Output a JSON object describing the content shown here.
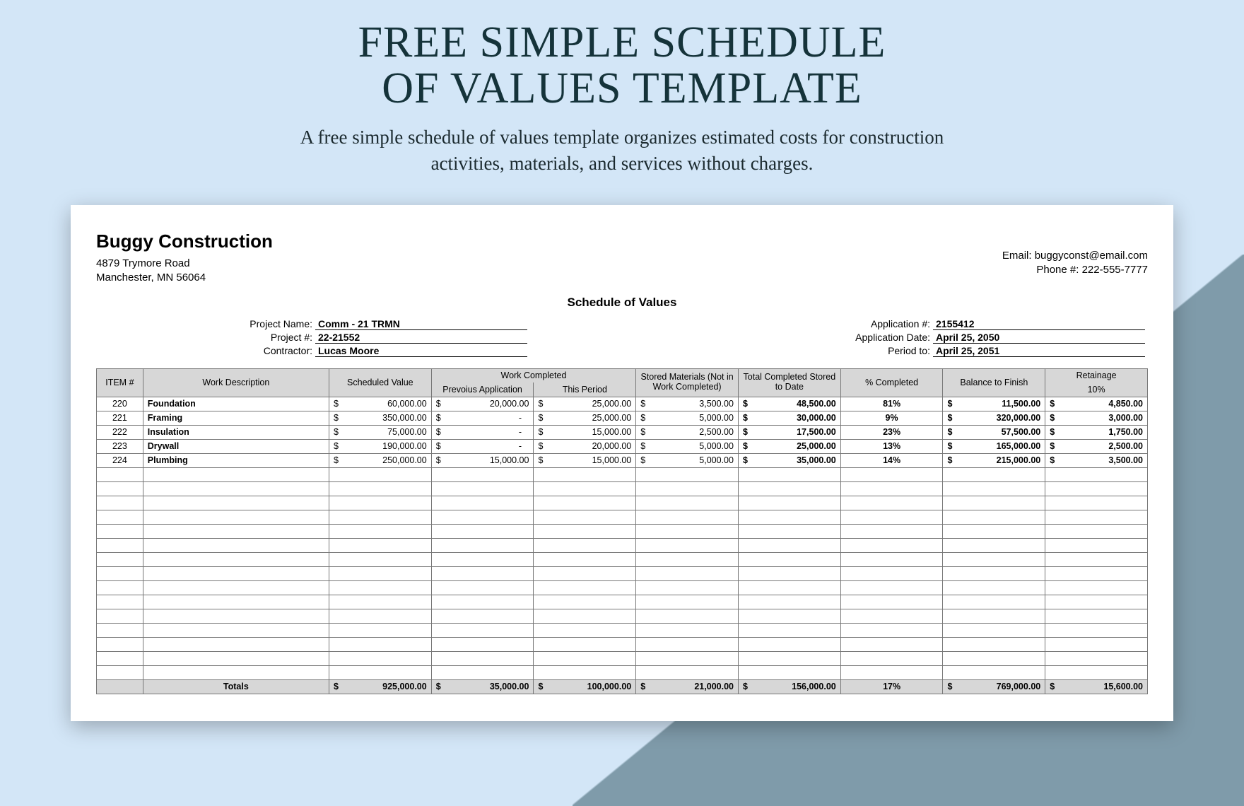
{
  "hero": {
    "title_l1": "FREE SIMPLE SCHEDULE",
    "title_l2": "OF VALUES TEMPLATE",
    "sub_l1": "A free simple schedule of values template organizes estimated costs for construction",
    "sub_l2": "activities, materials, and services without charges."
  },
  "company": {
    "name": "Buggy Construction",
    "addr1": "4879 Trymore Road",
    "addr2": "Manchester, MN 56064",
    "email": "Email: buggyconst@email.com",
    "phone": "Phone #: 222-555-7777"
  },
  "doc_title": "Schedule of Values",
  "meta_left": {
    "project_name_lbl": "Project Name:",
    "project_name": "Comm - 21 TRMN",
    "project_no_lbl": "Project #:",
    "project_no": "22-21552",
    "contractor_lbl": "Contractor:",
    "contractor": "Lucas Moore"
  },
  "meta_right": {
    "app_no_lbl": "Application #:",
    "app_no": "2155412",
    "app_date_lbl": "Application Date:",
    "app_date": "April 25, 2050",
    "period_lbl": "Period to:",
    "period": "April 25, 2051"
  },
  "headers": {
    "item": "ITEM #",
    "desc": "Work Description",
    "sched": "Scheduled Value",
    "wc": "Work Completed",
    "prev": "Prevoius Application",
    "this": "This Period",
    "stored": "Stored Materials (Not in Work Completed)",
    "total": "Total Completed Stored to Date",
    "pct": "% Completed",
    "bal": "Balance to Finish",
    "ret": "Retainage",
    "ret_pct": "10%"
  },
  "rows": [
    {
      "item": "220",
      "desc": "Foundation",
      "sched": "60,000.00",
      "prev": "20,000.00",
      "this": "25,000.00",
      "stored": "3,500.00",
      "total": "48,500.00",
      "pct": "81%",
      "bal": "11,500.00",
      "ret": "4,850.00"
    },
    {
      "item": "221",
      "desc": "Framing",
      "sched": "350,000.00",
      "prev": "-",
      "this": "25,000.00",
      "stored": "5,000.00",
      "total": "30,000.00",
      "pct": "9%",
      "bal": "320,000.00",
      "ret": "3,000.00"
    },
    {
      "item": "222",
      "desc": "Insulation",
      "sched": "75,000.00",
      "prev": "-",
      "this": "15,000.00",
      "stored": "2,500.00",
      "total": "17,500.00",
      "pct": "23%",
      "bal": "57,500.00",
      "ret": "1,750.00"
    },
    {
      "item": "223",
      "desc": "Drywall",
      "sched": "190,000.00",
      "prev": "-",
      "this": "20,000.00",
      "stored": "5,000.00",
      "total": "25,000.00",
      "pct": "13%",
      "bal": "165,000.00",
      "ret": "2,500.00"
    },
    {
      "item": "224",
      "desc": "Plumbing",
      "sched": "250,000.00",
      "prev": "15,000.00",
      "this": "15,000.00",
      "stored": "5,000.00",
      "total": "35,000.00",
      "pct": "14%",
      "bal": "215,000.00",
      "ret": "3,500.00"
    }
  ],
  "empty_rows": 15,
  "totals": {
    "label": "Totals",
    "sched": "925,000.00",
    "prev": "35,000.00",
    "this": "100,000.00",
    "stored": "21,000.00",
    "total": "156,000.00",
    "pct": "17%",
    "bal": "769,000.00",
    "ret": "15,600.00"
  }
}
